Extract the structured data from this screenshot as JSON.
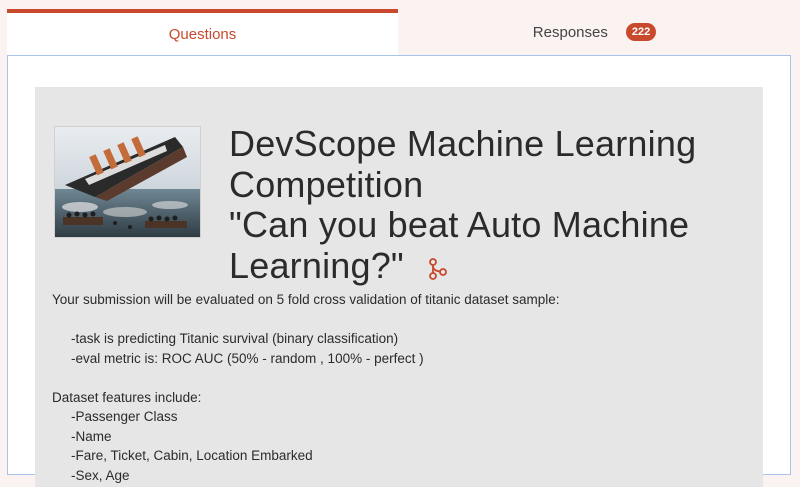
{
  "tabs": {
    "questions_label": "Questions",
    "responses_label": "Responses",
    "responses_count": "222"
  },
  "form": {
    "title_lines": [
      "DevScope Machine Learning",
      "Competition",
      "\"Can you beat Auto Machine",
      "Learning?\""
    ],
    "title_icon": "fork-icon",
    "image_icon": "ship-sinking-illustration",
    "description": {
      "intro": "Your submission will be evaluated on 5 fold cross validation of titanic dataset sample:",
      "task_line": "-task is predicting Titanic survival (binary classification)",
      "metric_line": "-eval metric is: ROC AUC (50% - random , 100% - perfect )",
      "features_header": "Dataset features include:",
      "features": [
        "-Passenger Class",
        "-Name",
        "-Fare, Ticket, Cabin, Location Embarked",
        "-Sex, Age"
      ]
    }
  },
  "colors": {
    "accent": "#c8492c",
    "card_bg": "#e6e6e6",
    "panel_border": "#a9c4ea",
    "page_bg": "#fbf3f1"
  }
}
